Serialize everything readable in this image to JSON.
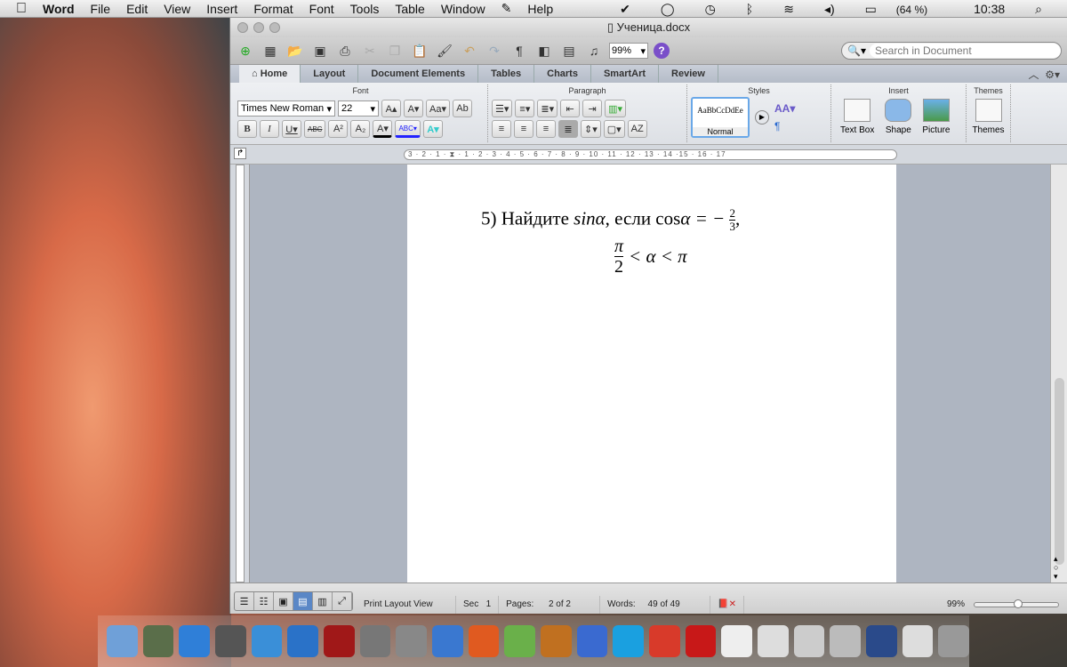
{
  "menubar": {
    "app": "Word",
    "items": [
      "File",
      "Edit",
      "View",
      "Insert",
      "Format",
      "Font",
      "Tools",
      "Table",
      "Window",
      "Help"
    ],
    "battery": "(64 %)",
    "time": "10:38"
  },
  "window": {
    "title": "Ученица.docx"
  },
  "toolbar": {
    "zoom": "99%",
    "search_placeholder": "Search in Document"
  },
  "tabs": [
    "Home",
    "Layout",
    "Document Elements",
    "Tables",
    "Charts",
    "SmartArt",
    "Review"
  ],
  "ribbon": {
    "font_group": "Font",
    "paragraph_group": "Paragraph",
    "styles_group": "Styles",
    "insert_group": "Insert",
    "themes_group": "Themes",
    "font_name": "Times New Roman",
    "font_size": "22",
    "style_preview": "AaBbCcDdEe",
    "style_name": "Normal",
    "text_box": "Text Box",
    "shape": "Shape",
    "picture": "Picture",
    "themes": "Themes"
  },
  "ruler": {
    "marks": "3 · 2 · 1 · ⧗ · 1 · 2 · 3 · 4 · 5 · 6 · 7 · 8 · 9 · 10 · 11 · 12 · 13 · 14 ·15 · 16 · 17"
  },
  "document": {
    "line1_prefix": "5) Найдите ",
    "sin": "sinα",
    "mid": ", если cos",
    "alpha": "α = −",
    "frac_num": "2",
    "frac_den": "3",
    "comma": ",",
    "pi": "π",
    "two": "2",
    "ineq": "< α < π"
  },
  "status": {
    "view": "Print Layout View",
    "sec_label": "Sec",
    "sec": "1",
    "pages_label": "Pages:",
    "pages": "2 of 2",
    "words_label": "Words:",
    "words": "49 of 49",
    "zoom": "99%",
    "zoom_fraction": 0.5
  },
  "dock_colors": [
    "#6fa0d8",
    "#5a6e4a",
    "#2f7fd8",
    "#555",
    "#3a8fd8",
    "#2a72c8",
    "#a01818",
    "#777",
    "#888",
    "#3a78d0",
    "#e05a20",
    "#6ab04a",
    "#c07020",
    "#3a6ad0",
    "#1aa0e0",
    "#d83a2a",
    "#c81818",
    "#eee",
    "#ddd",
    "#ccc",
    "#bbb",
    "#2a4a8a",
    "#ddd",
    "#999"
  ]
}
